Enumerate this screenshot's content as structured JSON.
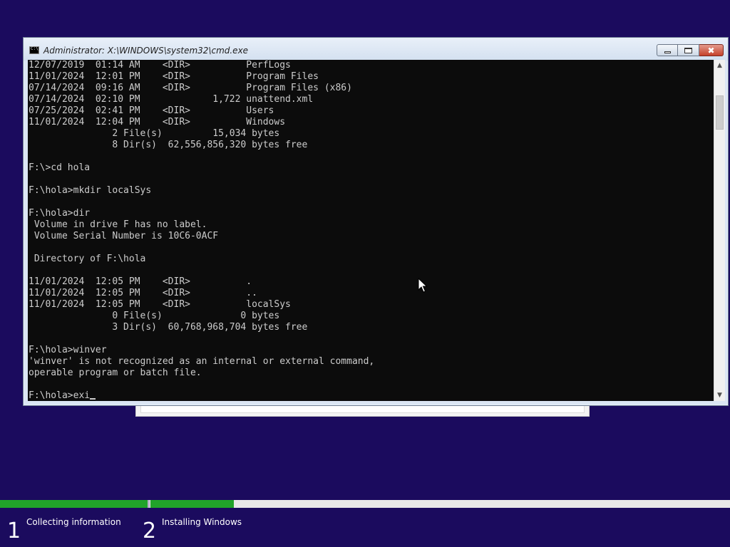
{
  "window": {
    "title": "Administrator: X:\\WINDOWS\\system32\\cmd.exe",
    "minimize_label": "",
    "maximize_label": "",
    "close_label": "✖"
  },
  "console": {
    "lines": [
      "12/07/2019  01:14 AM    <DIR>          PerfLogs",
      "11/01/2024  12:01 PM    <DIR>          Program Files",
      "07/14/2024  09:16 AM    <DIR>          Program Files (x86)",
      "07/14/2024  02:10 PM             1,722 unattend.xml",
      "07/25/2024  02:41 PM    <DIR>          Users",
      "11/01/2024  12:04 PM    <DIR>          Windows",
      "               2 File(s)         15,034 bytes",
      "               8 Dir(s)  62,556,856,320 bytes free",
      "",
      "F:\\>cd hola",
      "",
      "F:\\hola>mkdir localSys",
      "",
      "F:\\hola>dir",
      " Volume in drive F has no label.",
      " Volume Serial Number is 10C6-0ACF",
      "",
      " Directory of F:\\hola",
      "",
      "11/01/2024  12:05 PM    <DIR>          .",
      "11/01/2024  12:05 PM    <DIR>          ..",
      "11/01/2024  12:05 PM    <DIR>          localSys",
      "               0 File(s)              0 bytes",
      "               3 Dir(s)  60,768,968,704 bytes free",
      "",
      "F:\\hola>winver",
      "'winver' is not recognized as an internal or external command,",
      "operable program or batch file.",
      ""
    ],
    "current_input": "F:\\hola>exi"
  },
  "setup": {
    "progress_fraction": 0.32,
    "steps": [
      {
        "number": "1",
        "label": "Collecting information"
      },
      {
        "number": "2",
        "label": "Installing Windows"
      }
    ]
  },
  "colors": {
    "background": "#1b0b5e",
    "progress": "#21a32a",
    "console_bg": "#0c0c0c",
    "console_text": "#cccccc"
  },
  "icons": {
    "window_icon": "cmd-icon",
    "pointer": "mouse-pointer-icon"
  }
}
